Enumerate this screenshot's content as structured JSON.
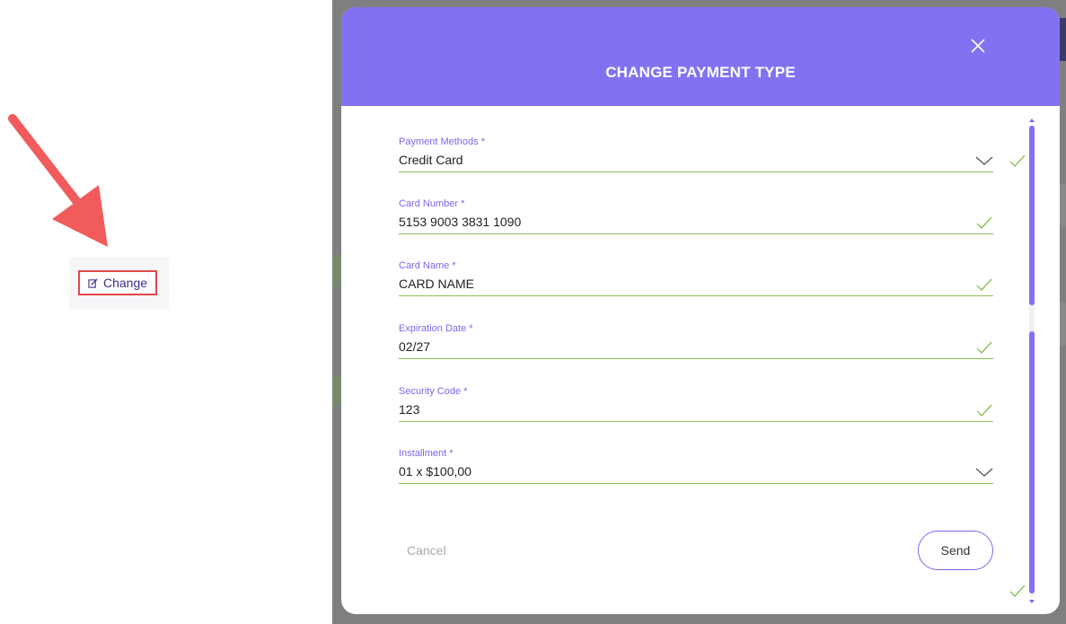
{
  "left": {
    "change_label": "Change"
  },
  "modal": {
    "title": "CHANGE PAYMENT TYPE",
    "fields": [
      {
        "label": "Payment Methods *",
        "value": "Credit Card"
      },
      {
        "label": "Card Number *",
        "value": "5153 9003 3831 1090"
      },
      {
        "label": "Card Name *",
        "value": "CARD NAME"
      },
      {
        "label": "Expiration Date *",
        "value": "02/27"
      },
      {
        "label": "Security Code *",
        "value": "123"
      },
      {
        "label": "Installment *",
        "value": "01 x $100,00"
      }
    ],
    "cancel_label": "Cancel",
    "send_label": "Send"
  },
  "colors": {
    "accent": "#8272f2",
    "label": "#7a68ee",
    "valid": "#8cbf5a",
    "highlight": "#e0484a"
  },
  "icons": {
    "close": "close-icon",
    "dropdown": "chevron-down-icon",
    "valid": "check-icon",
    "edit": "edit-icon",
    "annotation": "arrow-icon"
  }
}
